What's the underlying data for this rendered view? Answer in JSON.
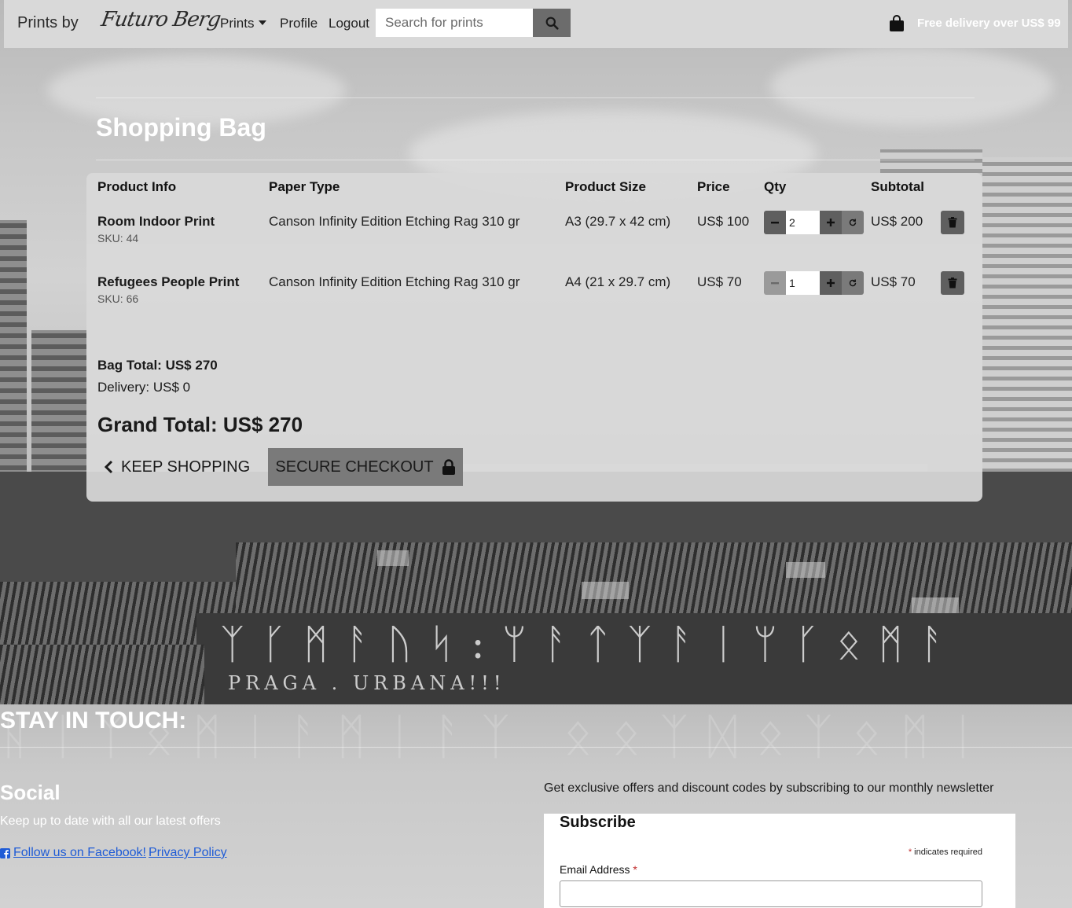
{
  "navbar": {
    "brand_text": "Prints by",
    "brand_logo": "Futuro Berg",
    "links": {
      "prints": "Prints",
      "profile": "Profile",
      "logout": "Logout"
    },
    "search": {
      "placeholder": "Search for prints",
      "icon": "search-icon"
    },
    "bag_icon": "shopping-bag-icon",
    "delivery_note": "Free delivery over US$ 99"
  },
  "page": {
    "title": "Shopping Bag"
  },
  "bag": {
    "headers": {
      "product_info": "Product Info",
      "paper_type": "Paper Type",
      "product_size": "Product Size",
      "price": "Price",
      "qty": "Qty",
      "subtotal": "Subtotal"
    },
    "items": [
      {
        "name": "Room Indoor Print",
        "sku": "SKU: 44",
        "paper": "Canson Infinity Edition Etching Rag 310 gr",
        "size": "A3 (29.7 x 42 cm)",
        "price": "US$ 100",
        "qty": "2",
        "subtotal": "US$ 200"
      },
      {
        "name": "Refugees People Print",
        "sku": "SKU: 66",
        "paper": "Canson Infinity Edition Etching Rag 310 gr",
        "size": "A4 (21 x 29.7 cm)",
        "price": "US$ 70",
        "qty": "1",
        "subtotal": "US$ 70"
      }
    ],
    "bag_total": "Bag Total: US$ 270",
    "delivery": "Delivery: US$ 0",
    "grand_total": "Grand Total: US$ 270",
    "keep_shopping": "KEEP SHOPPING",
    "secure_checkout": "SECURE CHECKOUT"
  },
  "footer": {
    "stay_in_touch": "STAY IN TOUCH:",
    "social_heading": "Social",
    "social_text": "Keep up to date with all our latest offers",
    "facebook_link": "Follow us on Facebook!",
    "privacy_link": "Privacy Policy",
    "newsletter_text": "Get exclusive offers and discount codes by subscribing to our monthly newsletter",
    "subscribe": {
      "title": "Subscribe",
      "required_note": "indicates required",
      "asterisk": "*",
      "email_label": "Email Address"
    }
  },
  "background": {
    "graffiti_1": "PRAGA . URBANA!!!"
  },
  "colors": {
    "navbar_bg": "#d9d9d9",
    "card_bg": "#d9d9d9",
    "button_dark": "#5f5f5f",
    "checkout_bg": "#7a7a7a",
    "link": "#1e5bd6",
    "required": "#c02b2b"
  }
}
